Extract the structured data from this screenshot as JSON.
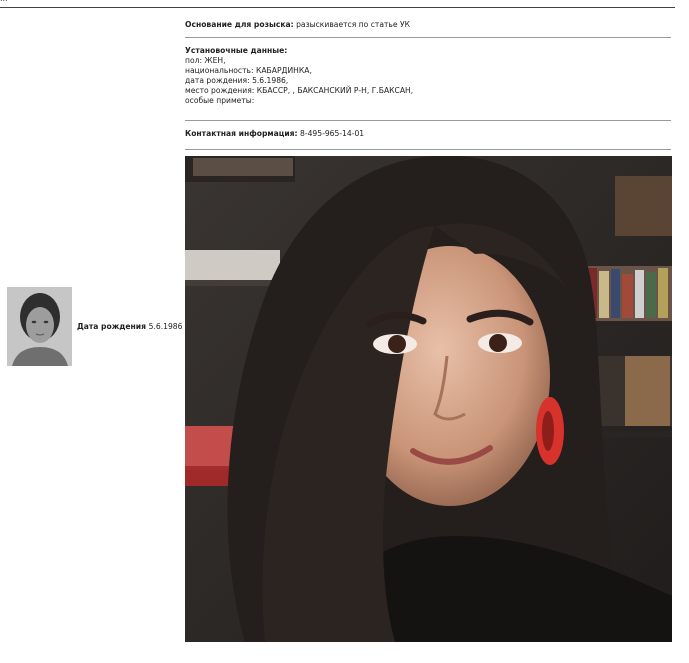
{
  "header": {
    "cut_text": "…"
  },
  "profile": {
    "dob_label": "Дата рождения",
    "dob_value": "5.6.1986"
  },
  "search_basis": {
    "label": "Основание для розыска:",
    "value": "разыскивается по статье УК"
  },
  "identity": {
    "heading": "Установочные данные:",
    "lines": [
      "пол: ЖЕН,",
      "национальность: КАБАРДИНКА,",
      "дата рождения: 5.6.1986,",
      "место рождения: КБАССР, , БАКСАНСКИЙ Р-Н, Г.БАКСАН,",
      "особые приметы:"
    ]
  },
  "contact": {
    "label": "Контактная информация:",
    "value": "8-495-965-14-01"
  },
  "colors": {
    "accent_earring": "#d8322c",
    "rule": "#9a9a9a"
  }
}
